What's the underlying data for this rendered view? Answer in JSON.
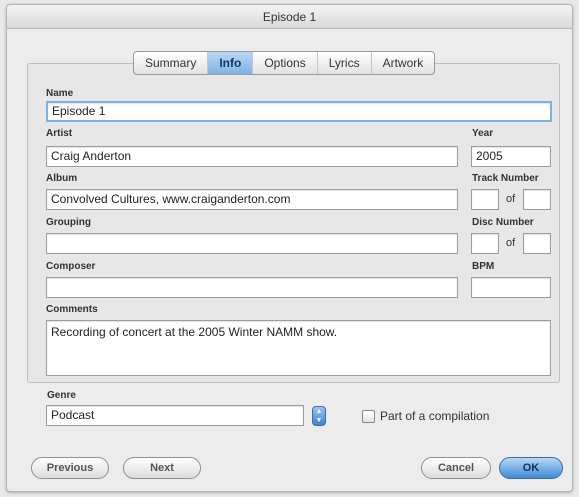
{
  "window": {
    "title": "Episode 1"
  },
  "tabs": [
    {
      "label": "Summary",
      "active": false
    },
    {
      "label": "Info",
      "active": true
    },
    {
      "label": "Options",
      "active": false
    },
    {
      "label": "Lyrics",
      "active": false
    },
    {
      "label": "Artwork",
      "active": false
    }
  ],
  "fields": {
    "name": {
      "label": "Name",
      "value": "Episode 1"
    },
    "artist": {
      "label": "Artist",
      "value": "Craig Anderton"
    },
    "year": {
      "label": "Year",
      "value": "2005"
    },
    "album": {
      "label": "Album",
      "value": "Convolved Cultures, www.craiganderton.com"
    },
    "track_number": {
      "label": "Track Number",
      "value": "",
      "of_label": "of",
      "total": ""
    },
    "grouping": {
      "label": "Grouping",
      "value": ""
    },
    "disc_number": {
      "label": "Disc Number",
      "value": "",
      "of_label": "of",
      "total": ""
    },
    "composer": {
      "label": "Composer",
      "value": ""
    },
    "bpm": {
      "label": "BPM",
      "value": ""
    },
    "comments": {
      "label": "Comments",
      "value": "Recording of concert at the 2005 Winter NAMM show."
    },
    "genre": {
      "label": "Genre",
      "value": "Podcast"
    }
  },
  "compilation": {
    "label": "Part of a compilation",
    "checked": false
  },
  "buttons": {
    "previous": "Previous",
    "next": "Next",
    "cancel": "Cancel",
    "ok": "OK"
  },
  "colors": {
    "accent": "#4a8fd9",
    "focus_ring": "#7fb0e4"
  }
}
